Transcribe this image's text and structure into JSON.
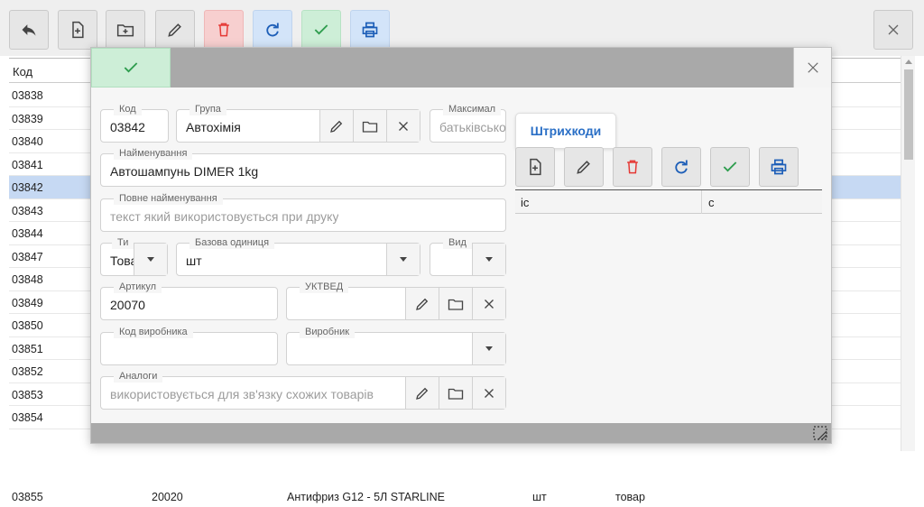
{
  "toolbar": {
    "buttons": [
      {
        "icon": "back-arrow-icon"
      },
      {
        "icon": "file-add-icon"
      },
      {
        "icon": "folder-add-icon"
      },
      {
        "icon": "pencil-icon"
      },
      {
        "icon": "trash-icon"
      },
      {
        "icon": "refresh-icon"
      },
      {
        "icon": "check-icon"
      },
      {
        "icon": "printer-icon"
      },
      {
        "icon": "close-icon"
      }
    ]
  },
  "table": {
    "header_code": "Код",
    "rows": [
      "03838",
      "03839",
      "03840",
      "03841",
      "03842",
      "03843",
      "03844",
      "03847",
      "03848",
      "03849",
      "03850",
      "03851",
      "03852",
      "03853",
      "03854",
      "03855"
    ],
    "selected_code": "03842",
    "last_row_extra": [
      "20020",
      "Антифриз G12 - 5Л STARLINE",
      "шт",
      "товар"
    ]
  },
  "form": {
    "kod": {
      "label": "Код",
      "value": "03842"
    },
    "grupa": {
      "label": "Група",
      "value": "Автохімія"
    },
    "max": {
      "label": "Максимал",
      "placeholder": "батьківсько"
    },
    "naim": {
      "label": "Найменування",
      "value": "Автошампунь DIMER 1kg"
    },
    "povne": {
      "label": "Повне найменування",
      "placeholder": "текст який використовується при друку"
    },
    "typ": {
      "label": "Ти",
      "value": "Това"
    },
    "baz": {
      "label": "Базова одиниця",
      "value": "шт"
    },
    "vyd": {
      "label": "Вид",
      "value": ""
    },
    "artykul": {
      "label": "Артикул",
      "value": "20070"
    },
    "uktved": {
      "label": "УКТВЕД",
      "value": ""
    },
    "kod_vyr": {
      "label": "Код виробника",
      "value": ""
    },
    "vyrobnyk": {
      "label": "Виробник",
      "value": ""
    },
    "analogy": {
      "label": "Аналоги",
      "placeholder": "використовується для зв'язку схожих товарів"
    }
  },
  "barcodes": {
    "tab_label": "Штрихкоди",
    "col_ic": "ic",
    "col_c": "c"
  },
  "colors": {
    "selection": "#c6d9f3",
    "accent": "#2a6fc6",
    "danger": "#e53935",
    "success": "#2e9d4e"
  }
}
